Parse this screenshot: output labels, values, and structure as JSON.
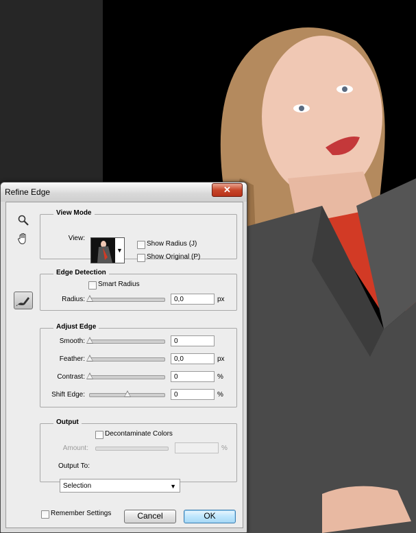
{
  "dialog": {
    "title": "Refine Edge",
    "close_glyph": "✕"
  },
  "tools": {
    "zoom": "zoom-tool-icon",
    "hand": "hand-tool-icon",
    "refine": "refine-radius-tool-icon"
  },
  "view_mode": {
    "group_title": "View Mode",
    "view_label": "View:",
    "show_radius": {
      "label": "Show Radius (J)",
      "checked": false
    },
    "show_original": {
      "label": "Show Original (P)",
      "checked": false
    }
  },
  "edge_detection": {
    "group_title": "Edge Detection",
    "smart_radius": {
      "label": "Smart Radius",
      "checked": false
    },
    "radius": {
      "label": "Radius:",
      "value": "0,0",
      "unit": "px",
      "level": 0
    }
  },
  "adjust_edge": {
    "group_title": "Adjust Edge",
    "smooth": {
      "label": "Smooth:",
      "value": "0",
      "unit": "",
      "level": 0
    },
    "feather": {
      "label": "Feather:",
      "value": "0,0",
      "unit": "px",
      "level": 0
    },
    "contrast": {
      "label": "Contrast:",
      "value": "0",
      "unit": "%",
      "level": 0
    },
    "shift_edge": {
      "label": "Shift Edge:",
      "value": "0",
      "unit": "%",
      "level": 0.5
    }
  },
  "output": {
    "group_title": "Output",
    "decontaminate": {
      "label": "Decontaminate Colors",
      "checked": false
    },
    "amount": {
      "label": "Amount:",
      "value": "",
      "unit": "%",
      "enabled": false
    },
    "output_to_label": "Output To:",
    "output_to_value": "Selection"
  },
  "remember": {
    "label": "Remember Settings",
    "checked": false
  },
  "buttons": {
    "cancel": "Cancel",
    "ok": "OK"
  },
  "colors": {
    "background": "#000000",
    "left_panel": "#262626",
    "jacket": "#4a4a4a",
    "shirt": "#d23a25",
    "skin": "#f0c8b4",
    "hair": "#b48a5e"
  }
}
